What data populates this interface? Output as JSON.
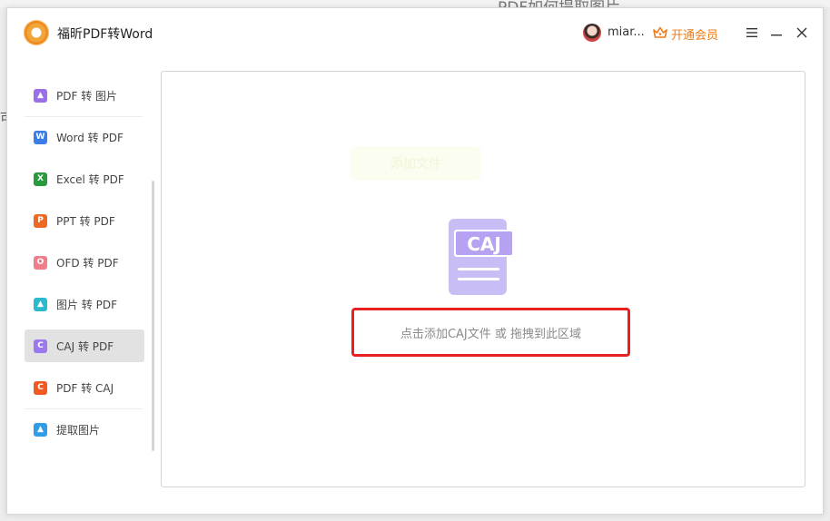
{
  "background": {
    "behind_title": "PDF如何提取图片",
    "left_char": "可"
  },
  "app": {
    "title": "福昕PDF转Word",
    "username": "miar...",
    "vip_label": "开通会员"
  },
  "colors": {
    "vip": "#f07b16",
    "highlight_border": "#e82020",
    "active_item_bg": "#e2e2e2",
    "caj_icon": "#b8a9f0"
  },
  "sidebar": {
    "items": [
      {
        "label": "PDF 转 图片",
        "icon": "image-pdf-icon",
        "icon_color": "#9a6fe8",
        "icon_char": "▲"
      },
      {
        "label": "Word 转 PDF",
        "icon": "word-icon",
        "icon_color": "#3b7de6",
        "icon_char": "W"
      },
      {
        "label": "Excel 转 PDF",
        "icon": "excel-icon",
        "icon_color": "#2a9a3e",
        "icon_char": "X"
      },
      {
        "label": "PPT 转 PDF",
        "icon": "ppt-icon",
        "icon_color": "#ec6a23",
        "icon_char": "P"
      },
      {
        "label": "OFD 转 PDF",
        "icon": "ofd-icon",
        "icon_color": "#f07e8a",
        "icon_char": "O"
      },
      {
        "label": "图片 转 PDF",
        "icon": "image-icon",
        "icon_color": "#2bbacb",
        "icon_char": "▲"
      },
      {
        "label": "CAJ 转 PDF",
        "icon": "caj-icon",
        "icon_color": "#9b78ec",
        "icon_char": "C",
        "active": true
      },
      {
        "label": "PDF 转 CAJ",
        "icon": "pdf-caj-icon",
        "icon_color": "#f05a22",
        "icon_char": "C"
      },
      {
        "label": "提取图片",
        "icon": "extract-image-icon",
        "icon_color": "#2f9de8",
        "icon_char": "▲"
      }
    ]
  },
  "main": {
    "ghost_button": "添加文件",
    "caj_label": "CAJ",
    "drop_hint": "点击添加CAJ文件 或 拖拽到此区域"
  }
}
